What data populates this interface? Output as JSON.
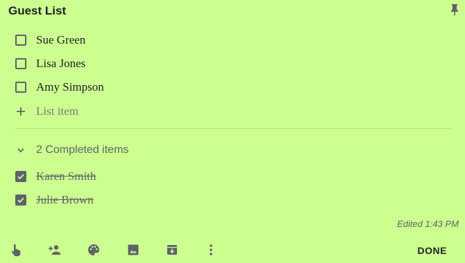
{
  "note": {
    "title": "Guest List",
    "items": [
      {
        "label": "Sue Green"
      },
      {
        "label": "Lisa Jones"
      },
      {
        "label": "Amy Simpson"
      }
    ],
    "add_item_placeholder": "List item",
    "completed_header": "2 Completed items",
    "completed_items": [
      {
        "label": "Karen Smith"
      },
      {
        "label": "Julie Brown"
      }
    ],
    "edited_text": "Edited 1:43 PM"
  },
  "toolbar": {
    "icons": [
      "hand-touch-icon",
      "add-collaborator-icon",
      "palette-icon",
      "image-icon",
      "archive-icon",
      "more-vert-icon"
    ],
    "done_label": "DONE"
  },
  "colors": {
    "background": "#ccff90",
    "icon": "#5f6368",
    "text": "#202124"
  }
}
